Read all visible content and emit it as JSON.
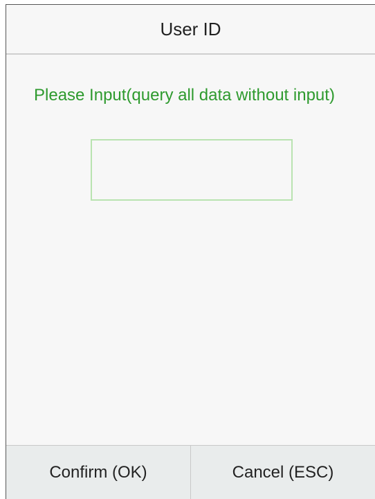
{
  "header": {
    "title": "User ID"
  },
  "main": {
    "prompt": "Please Input(query all data without input)",
    "user_id_input": {
      "value": ""
    }
  },
  "footer": {
    "confirm_label": "Confirm (OK)",
    "cancel_label": "Cancel (ESC)"
  },
  "colors": {
    "prompt_text": "#2e9a2e",
    "input_border": "#b9e3b0",
    "background": "#f7f7f7",
    "footer_background": "#e9ecec"
  }
}
